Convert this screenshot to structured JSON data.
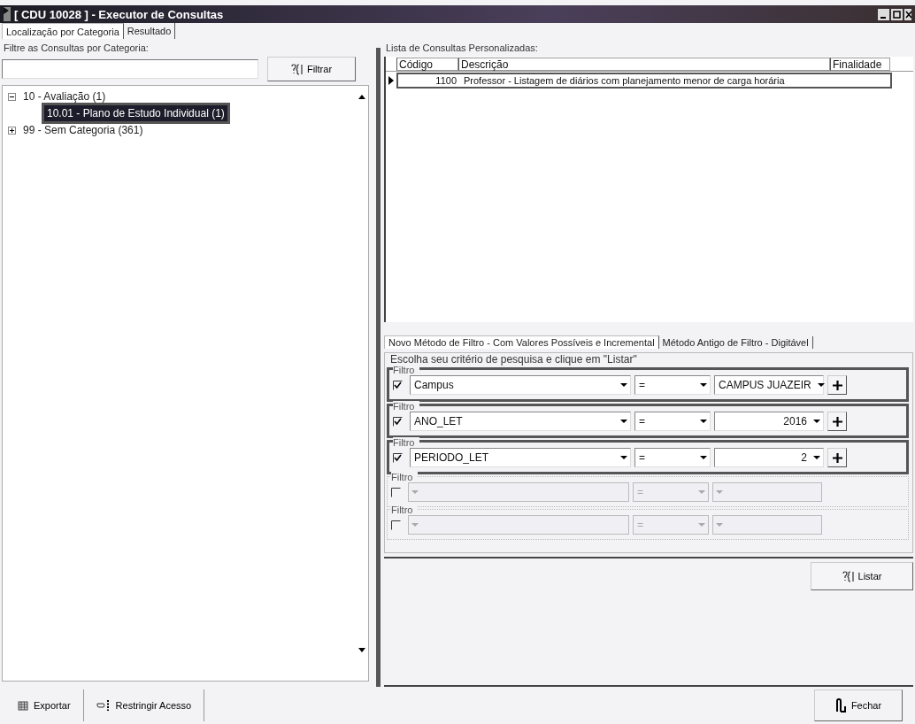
{
  "window": {
    "title": "[ CDU 10028 ] - Executor de Consultas"
  },
  "tabs": [
    {
      "label": "Localização por Categoria",
      "selected": true
    },
    {
      "label": "Resultado",
      "selected": false
    }
  ],
  "left": {
    "group_label": "Filtre as Consultas por Categoria:",
    "filter_button": "Filtrar",
    "tree": [
      {
        "label": "10 - Avaliação (1)",
        "expanded": true,
        "children": [
          {
            "label": "10.01 - Plano de Estudo Individual (1)",
            "selected": true
          }
        ]
      },
      {
        "label": "99 - Sem Categoria (361)",
        "expanded": false
      }
    ]
  },
  "right": {
    "list_label": "Lista de Consultas Personalizadas:",
    "table": {
      "columns": [
        "Código",
        "Descrição",
        "Finalidade"
      ],
      "rows": [
        {
          "cells": [
            "1100",
            "Professor - Listagem de diários com planejamento menor de carga horária"
          ],
          "selected": true
        }
      ]
    },
    "subtabs": [
      {
        "label": "Novo Método de Filtro - Com Valores Possíveis e Incremental",
        "selected": true
      },
      {
        "label": "Método Antigo de Filtro - Digitável",
        "selected": false
      }
    ],
    "criteria_label": "Escolha seu critério de pesquisa e clique em \"Listar\"",
    "filters": [
      {
        "label": "Filtro",
        "enabled": true,
        "checked": true,
        "field": "Campus",
        "operator": "=",
        "value": "CAMPUS JUAZEIR",
        "kind": "text"
      },
      {
        "label": "Filtro",
        "enabled": true,
        "checked": true,
        "field": "ANO_LET",
        "operator": "=",
        "value": "2016",
        "kind": "number"
      },
      {
        "label": "Filtro",
        "enabled": true,
        "checked": true,
        "field": "PERIODO_LET",
        "operator": "=",
        "value": "2",
        "kind": "number"
      },
      {
        "label": "Filtro",
        "enabled": false,
        "checked": false,
        "operator": "="
      },
      {
        "label": "Filtro",
        "enabled": false,
        "checked": false,
        "operator": "="
      }
    ],
    "list_button": "Listar"
  },
  "footer": {
    "export_button": "Exportar",
    "restrict_button": "Restringir Acesso",
    "close_button": "Fechar"
  }
}
